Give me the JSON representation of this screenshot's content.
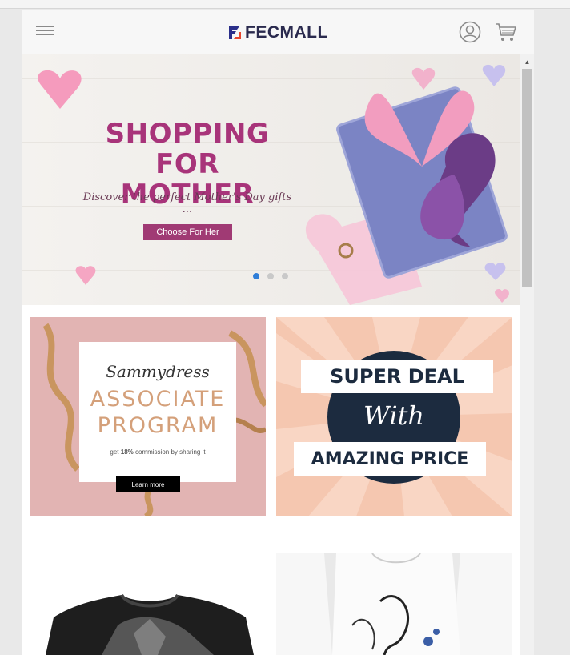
{
  "app": {
    "logo_text": "FECMALL"
  },
  "banner": {
    "title_line1": "SHOPPING FOR",
    "title_line2": "MOTHER",
    "subtitle": "Discover the perfect Mother's Day gifts ...",
    "button_label": "Choose For Her",
    "slide_count": 3,
    "active_slide": 1
  },
  "promos": [
    {
      "brand": "Sammydress",
      "title_line1": "ASSOCIATE",
      "title_line2": "PROGRAM",
      "commission_prefix": "get ",
      "commission_value": "18%",
      "commission_suffix": " commission by sharing it",
      "button_label": "Learn more"
    },
    {
      "line1": "SUPER DEAL",
      "line2": "With",
      "line3": "AMAZING PRICE"
    }
  ],
  "icons": {
    "menu": "hamburger-menu-icon",
    "account": "user-circle-icon",
    "cart": "shopping-cart-icon"
  },
  "colors": {
    "banner_title": "#a8347a",
    "banner_button": "#a03a74",
    "active_dot": "#2f7ed8",
    "deal_navy": "#1c2b3f",
    "promo_pink": "#e2b4b3",
    "promo_peach": "#f5c7b0"
  }
}
